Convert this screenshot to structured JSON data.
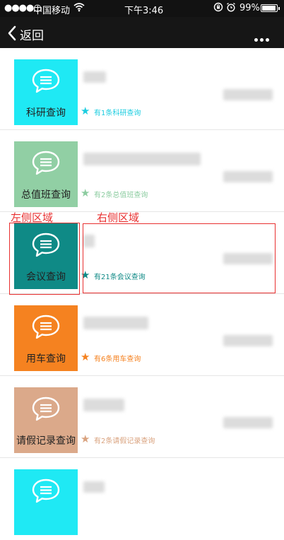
{
  "status_bar": {
    "signal": "●●●●○",
    "carrier": "中国移动",
    "time": "下午3:46",
    "battery": "99%"
  },
  "nav": {
    "back_label": "返回"
  },
  "items": [
    {
      "label": "科研查询",
      "count_text": "有1条科研查询",
      "color": "#1fe9f4",
      "accent": "#1ccde0"
    },
    {
      "label": "总值班查询",
      "count_text": "有2条总值班查询",
      "color": "#91cfa4",
      "accent": "#8ccca0"
    },
    {
      "label": "会议查询",
      "count_text": "有21条会议查询",
      "color": "#0f8a86",
      "accent": "#0f8a86"
    },
    {
      "label": "用车查询",
      "count_text": "有6条用车查询",
      "color": "#f58220",
      "accent": "#f58220"
    },
    {
      "label": "请假记录查询",
      "count_text": "有2条请假记录查询",
      "color": "#dba98a",
      "accent": "#d9a27e"
    },
    {
      "label": "",
      "count_text": "",
      "color": "#1fe9f4",
      "accent": "#1ccde0"
    }
  ],
  "annotations": {
    "left_label": "左侧区域",
    "right_label": "右侧区域",
    "color": "#e83030"
  }
}
